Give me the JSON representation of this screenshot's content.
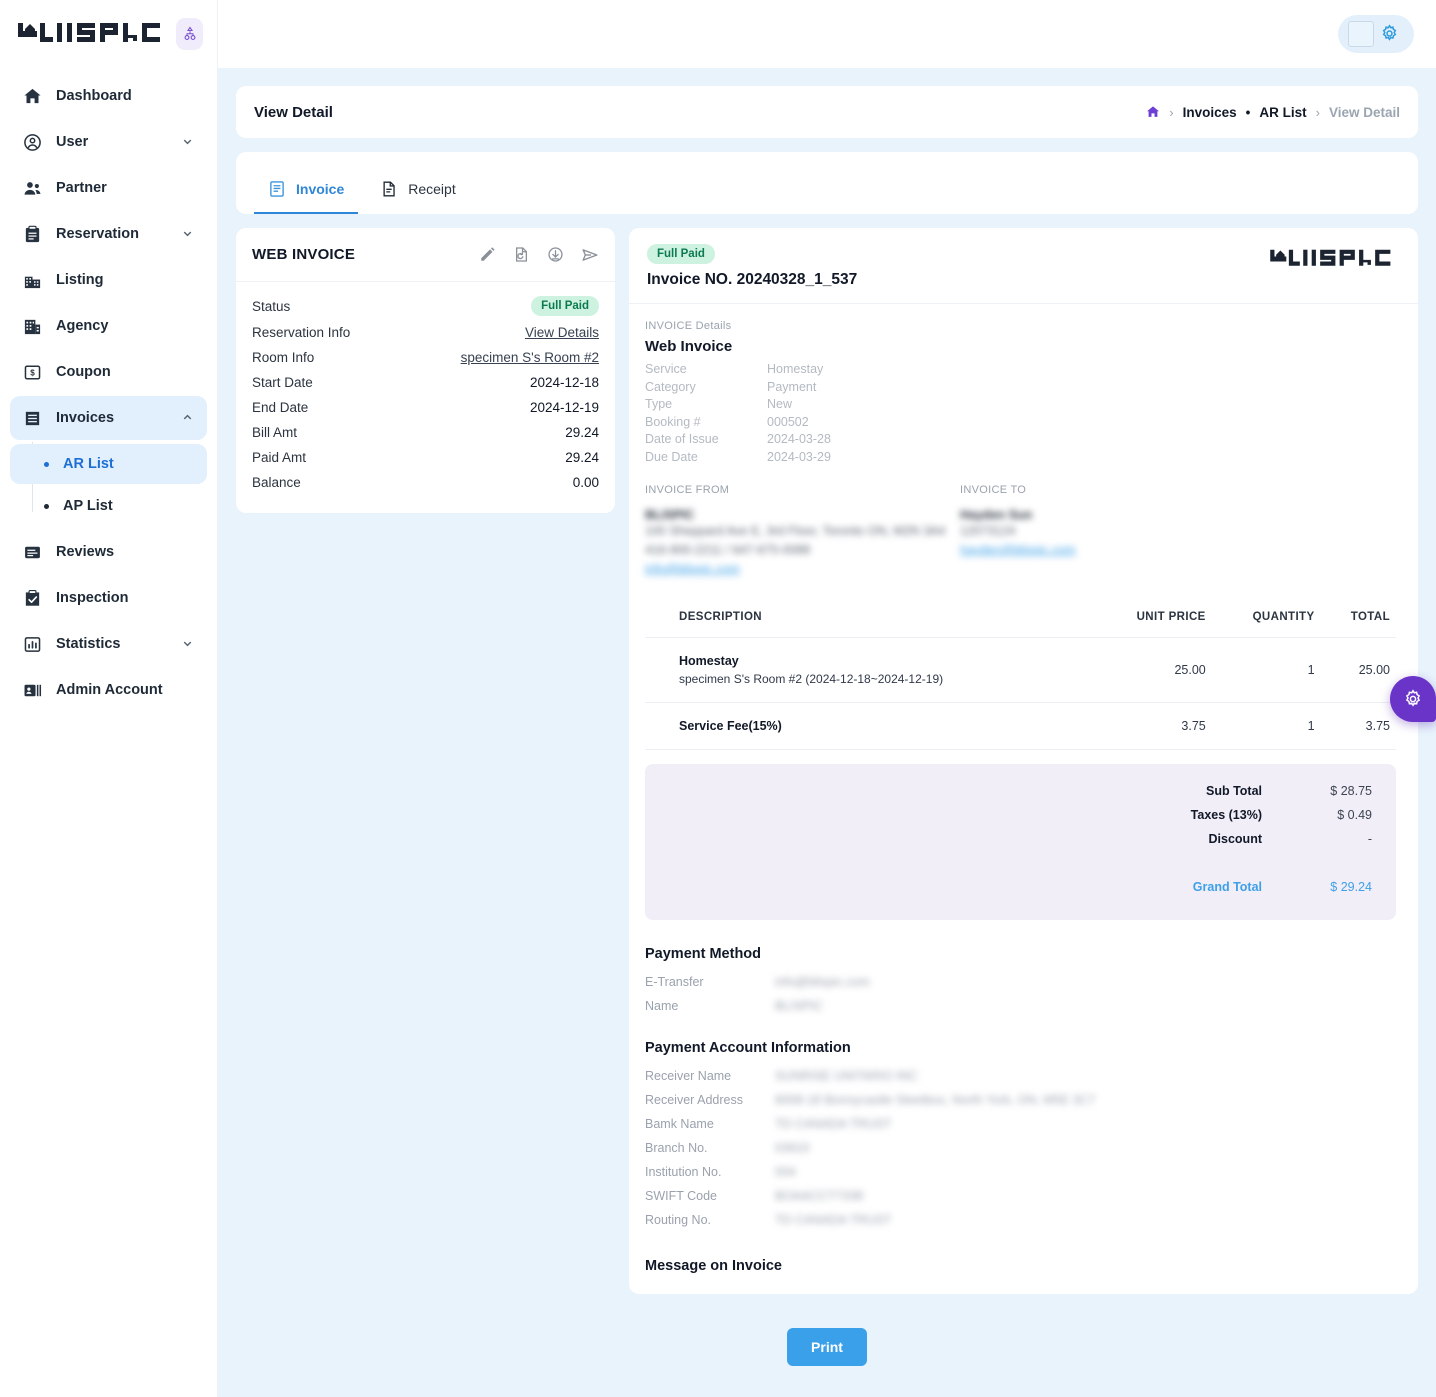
{
  "brand": {
    "name": "BLISPIC",
    "toggle_icon": "sitemap-icon"
  },
  "topbar": {
    "avatar_icon": "avatar-placeholder",
    "gear_icon": "gear-icon"
  },
  "sidebar": {
    "items": [
      {
        "label": "Dashboard",
        "icon": "home-icon",
        "expandable": false
      },
      {
        "label": "User",
        "icon": "user-circle-icon",
        "expandable": true
      },
      {
        "label": "Partner",
        "icon": "people-icon",
        "expandable": false
      },
      {
        "label": "Reservation",
        "icon": "clipboard-icon",
        "expandable": true
      },
      {
        "label": "Listing",
        "icon": "buildings-icon",
        "expandable": false
      },
      {
        "label": "Agency",
        "icon": "office-icon",
        "expandable": false
      },
      {
        "label": "Coupon",
        "icon": "coupon-icon",
        "expandable": false
      },
      {
        "label": "Invoices",
        "icon": "invoice-icon",
        "expandable": true,
        "active": true
      },
      {
        "label": "Reviews",
        "icon": "review-icon",
        "expandable": false
      },
      {
        "label": "Inspection",
        "icon": "inspection-icon",
        "expandable": false
      },
      {
        "label": "Statistics",
        "icon": "chart-icon",
        "expandable": true
      },
      {
        "label": "Admin Account",
        "icon": "id-card-icon",
        "expandable": false
      }
    ],
    "subitems": [
      {
        "label": "AR List",
        "active": true
      },
      {
        "label": "AP List",
        "active": false
      }
    ]
  },
  "page": {
    "title": "View Detail",
    "breadcrumb": {
      "home_icon": "home-icon",
      "first": "Invoices",
      "dot": "•",
      "second": "AR List",
      "current": "View Detail",
      "sep": "›"
    }
  },
  "tabs": [
    {
      "label": "Invoice",
      "icon": "invoice-tab-icon",
      "active": true
    },
    {
      "label": "Receipt",
      "icon": "receipt-tab-icon",
      "active": false
    }
  ],
  "summary": {
    "title": "WEB INVOICE",
    "actions": [
      "edit-icon",
      "history-icon",
      "download-icon",
      "send-icon"
    ],
    "rows": [
      {
        "key": "Status",
        "value": "Full Paid",
        "type": "badge"
      },
      {
        "key": "Reservation Info",
        "value": "View Details",
        "type": "link"
      },
      {
        "key": "Room Info",
        "value": "specimen S's Room #2",
        "type": "link"
      },
      {
        "key": "Start Date",
        "value": "2024-12-18",
        "type": "text"
      },
      {
        "key": "End Date",
        "value": "2024-12-19",
        "type": "text"
      },
      {
        "key": "Bill Amt",
        "value": "29.24",
        "type": "text"
      },
      {
        "key": "Paid Amt",
        "value": "29.24",
        "type": "text"
      },
      {
        "key": "Balance",
        "value": "0.00",
        "type": "text"
      }
    ]
  },
  "invoice": {
    "status_badge": "Full Paid",
    "number_label": "Invoice NO. 20240328_1_537",
    "logo": "BLISPIC",
    "details_label": "INVOICE Details",
    "details_title": "Web Invoice",
    "details": [
      {
        "key": "Service",
        "value": "Homestay"
      },
      {
        "key": "Category",
        "value": "Payment"
      },
      {
        "key": "Type",
        "value": "New"
      },
      {
        "key": "Booking #",
        "value": "000502"
      },
      {
        "key": "Date of Issue",
        "value": "2024-03-28"
      },
      {
        "key": "Due Date",
        "value": "2024-03-29"
      }
    ],
    "from": {
      "label": "INVOICE FROM",
      "name": "BLISPIC",
      "lines": [
        "100 Sheppard Ave E, 3rd Floor, Toronto ON, M2N 3A4",
        "416-900-2211 / 647-675-0088"
      ],
      "email": "info@blispic.com"
    },
    "to": {
      "label": "INVOICE TO",
      "name": "Hayden Sun",
      "lines": [
        "12073124"
      ],
      "email": "hayden@blispic.com"
    },
    "table": {
      "headers": [
        "DESCRIPTION",
        "UNIT PRICE",
        "QUANTITY",
        "TOTAL"
      ],
      "rows": [
        {
          "description": "Homestay",
          "sub": "specimen S's Room #2 (2024-12-18~2024-12-19)",
          "unit_price": "25.00",
          "quantity": "1",
          "total": "25.00"
        },
        {
          "description": "Service Fee(15%)",
          "sub": "",
          "unit_price": "3.75",
          "quantity": "1",
          "total": "3.75"
        }
      ]
    },
    "totals": [
      {
        "key": "Sub Total",
        "value": "$ 28.75"
      },
      {
        "key": "Taxes (13%)",
        "value": "$ 0.49"
      },
      {
        "key": "Discount",
        "value": "-"
      }
    ],
    "grand_total": {
      "key": "Grand Total",
      "value": "$ 29.24"
    },
    "payment_method": {
      "title": "Payment Method",
      "rows": [
        {
          "key": "E-Transfer",
          "value": "info@blispic.com"
        },
        {
          "key": "Name",
          "value": "BLISPIC"
        }
      ]
    },
    "payment_account": {
      "title": "Payment Account Information",
      "rows": [
        {
          "key": "Receiver Name",
          "value": "SUNRISE UNITARIO INC"
        },
        {
          "key": "Receiver Address",
          "value": "8008-18 Bonnycastle Steetbox, North York, ON, M5E 3C7"
        },
        {
          "key": "Bamk Name",
          "value": "TD CANADA TRUST"
        },
        {
          "key": "Branch No.",
          "value": "03910"
        },
        {
          "key": "Institution No.",
          "value": "004"
        },
        {
          "key": "SWIFT Code",
          "value": "BOAACCT7338"
        },
        {
          "key": "Routing No.",
          "value": "TD CANADA TRUST"
        }
      ]
    },
    "message_title": "Message on Invoice"
  },
  "footer": {
    "print_label": "Print"
  },
  "fab": {
    "icon": "gear-icon"
  },
  "colors": {
    "page_bg": "#e8f3fc",
    "accent_blue": "#2f86d6",
    "badge_green_bg": "#cdf2e0",
    "badge_green_text": "#0d7a51",
    "totals_bg": "#f1eef8",
    "fab_purple": "#6b34c9",
    "print_blue": "#3aa0ea"
  }
}
